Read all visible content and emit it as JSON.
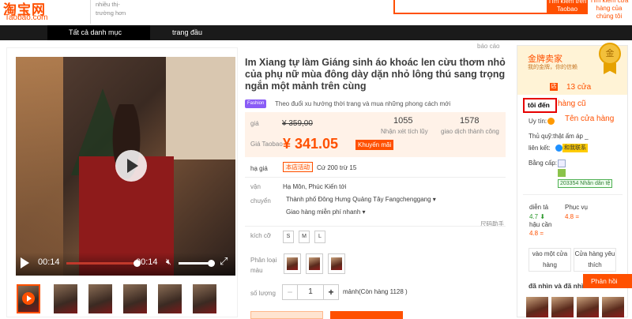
{
  "header": {
    "logo_cn": "淘宝网",
    "logo_en": "Taobao.com",
    "shop_subtitle": "nhiều thị- trường hơn",
    "search_taobao": "Tìm kiếm trên Taobao",
    "search_shop": "Tìm kiếm cửa hàng của chúng tôi"
  },
  "nav": {
    "all_categories": "Tất cả danh mục",
    "home": "trang đầu",
    "report": "báo cáo"
  },
  "video": {
    "time_current": "00:14",
    "time_total": "00:14",
    "progress": 1.0
  },
  "product": {
    "title": "Im Xiang tự làm Giáng sinh áo khoác len cừu thơm nhỏ của phụ nữ mùa đông dày dặn nhỏ lông thú sang trọng ngắn một mảnh trên cùng",
    "tag_label": "Fashion",
    "tag_text": "Theo đuổi xu hướng thời trang và mua những phong cách mới"
  },
  "price": {
    "label": "giá",
    "old_price": "¥ 359,00",
    "review_count": "1055",
    "review_label": "Nhận xét tích lũy",
    "sale_count": "1578",
    "sale_label": "giao dịch thành công",
    "taobao_label": "Giá Taobao",
    "new_price": "¥ 341.05",
    "promo_badge": "Khuyến mãi"
  },
  "discount": {
    "label": "hạ giá",
    "badge": "本店活动",
    "text": "Cứ 200 trừ 15"
  },
  "shipping": {
    "label_1": "vận",
    "label_2": "chuyển",
    "from": "Hạ Môn, Phúc Kiến tới",
    "to": "Thành phố Đông Hưng Quảng Tây Fangchenggang",
    "free": "Giao hàng miễn phí nhanh"
  },
  "size_chart": "尺码助手",
  "size": {
    "label": "kích cỡ",
    "options": [
      "S",
      "M",
      "L"
    ]
  },
  "color": {
    "label_1": "Phân loại",
    "label_2": "màu"
  },
  "quantity": {
    "label": "số lượng",
    "minus": "−",
    "value": "1",
    "plus": "+",
    "unit": "mảnh(Còn hàng 1128 )"
  },
  "seller": {
    "gold_title": "金牌卖家",
    "gold_sub": "我的金牌，你的信赖",
    "medal": "金",
    "store_icon": "店",
    "stores": "13 cửa",
    "highlight": "tôi đến",
    "old_store": "hàng cũ",
    "store_name": "Tên cửa hàng",
    "credit_label": "Uy tín:",
    "seller_label": "Thủ quỹ:thật ấm áp _",
    "contact_label": "liên kết:",
    "contact_badge": "和我联系",
    "cert_label": "Bằng cấp:",
    "cert_badge": "203354 Nhân dân tệ",
    "desc_label": "diễn tả",
    "desc_value": "4.7 ⬇",
    "ship_label": "hậu cần",
    "ship_value": "4.8 =",
    "serv_label": "Phục vụ",
    "serv_value": "4.8 =",
    "enter_store": "vào một cửa hàng",
    "fav_store": "Cửa hàng yêu thích",
    "seen_title": "đã nhìn và đã nhìn",
    "feedback": "Phản hồi"
  },
  "colors": {
    "accent": "#ff5000",
    "nav_bg": "#1a1a1a",
    "highlight_border": "#e60000"
  }
}
